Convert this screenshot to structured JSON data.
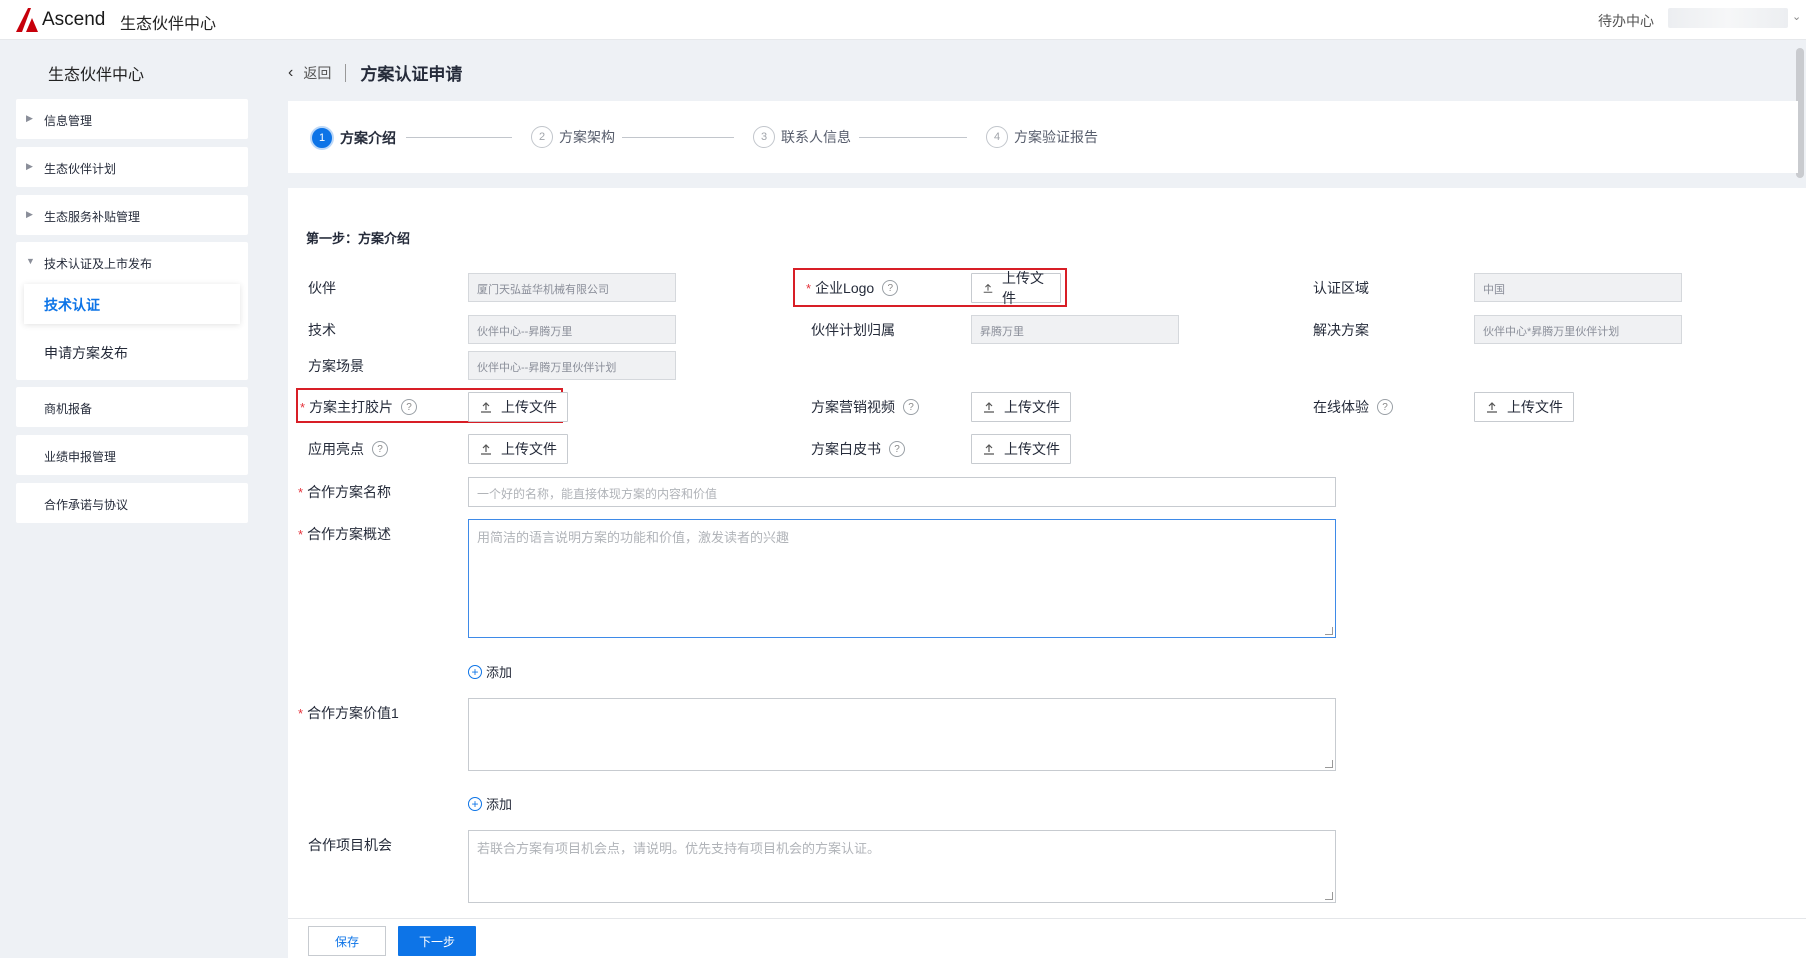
{
  "topbar": {
    "brand": "Ascend",
    "app_title": "生态伙伴中心",
    "todo": "待办中心"
  },
  "sidebar": {
    "title": "生态伙伴中心",
    "items": [
      {
        "label": "信息管理"
      },
      {
        "label": "生态伙伴计划"
      },
      {
        "label": "生态服务补贴管理"
      }
    ],
    "group": {
      "label": "技术认证及上市发布",
      "sub": [
        "技术认证",
        "申请方案发布"
      ]
    },
    "items2": [
      {
        "label": "商机报备"
      },
      {
        "label": "业绩申报管理"
      },
      {
        "label": "合作承诺与协议"
      }
    ]
  },
  "breadcrumb": {
    "back": "返回",
    "title": "方案认证申请"
  },
  "steps": [
    {
      "num": "1",
      "label": "方案介绍"
    },
    {
      "num": "2",
      "label": "方案架构"
    },
    {
      "num": "3",
      "label": "联系人信息"
    },
    {
      "num": "4",
      "label": "方案验证报告"
    }
  ],
  "form": {
    "section_title": "第一步：方案介绍",
    "upload_label": "上传文件",
    "help_glyph": "?",
    "required_mark": "*",
    "partner_label": "伙伴",
    "partner_value": "厦门天弘益华机械有限公司",
    "logo_label": "企业Logo",
    "region_label": "认证区域",
    "region_value": "中国",
    "tech_label": "技术",
    "tech_value": "伙伴中心--昇腾万里",
    "plan_owner_label": "伙伴计划归属",
    "plan_owner_value": "昇腾万里",
    "solution_label": "解决方案",
    "solution_value": "伙伴中心*昇腾万里伙伴计划",
    "scene_label": "方案场景",
    "scene_value": "伙伴中心--昇腾万里伙伴计划",
    "slide_label": "方案主打胶片",
    "video_label": "方案营销视频",
    "online_label": "在线体验",
    "highlight_label": "应用亮点",
    "whitepaper_label": "方案白皮书",
    "name_label": "合作方案名称",
    "name_placeholder": "一个好的名称，能直接体现方案的内容和价值",
    "overview_label": "合作方案概述",
    "overview_placeholder": "用简洁的语言说明方案的功能和价值，激发读者的兴趣",
    "add_label": "添加",
    "value_label": "合作方案价值1",
    "opportunity_label": "合作项目机会",
    "opportunity_placeholder": "若联合方案有项目机会点，请说明。优先支持有项目机会的方案认证。"
  },
  "footer": {
    "save": "保存",
    "next": "下一步"
  },
  "colors": {
    "primary": "#0d74e7",
    "required": "#e5323b",
    "highlight_box": "#d81e26"
  }
}
